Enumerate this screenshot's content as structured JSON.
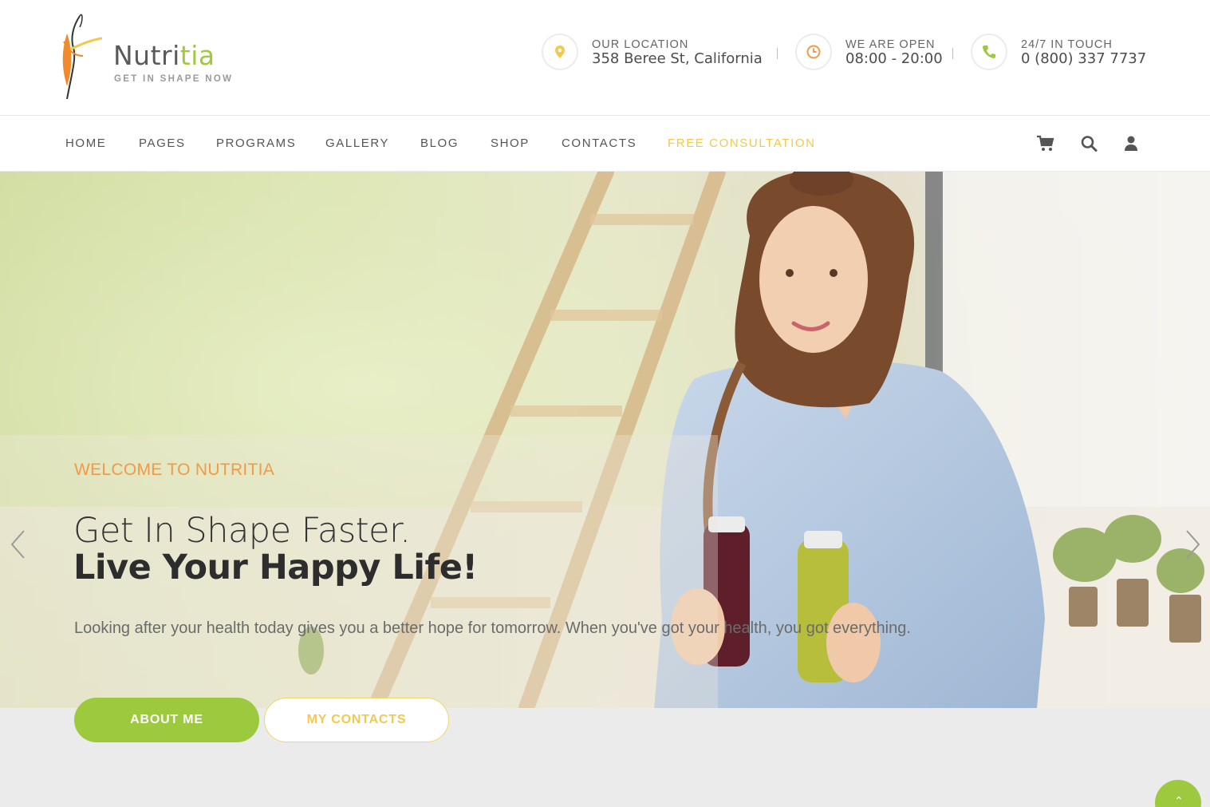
{
  "brand": {
    "name_start": "Nutri",
    "name_accent": "tia",
    "tagline": "GET IN SHAPE NOW"
  },
  "header_info": [
    {
      "icon": "location-pin-icon",
      "label": "OUR LOCATION",
      "value": "358 Beree St, California"
    },
    {
      "icon": "clock-icon",
      "label": "WE ARE OPEN",
      "value": "08:00 - 20:00"
    },
    {
      "icon": "phone-icon",
      "label": "24/7 IN TOUCH",
      "value": "0 (800) 337 7737"
    }
  ],
  "nav": {
    "items": [
      "HOME",
      "PAGES",
      "PROGRAMS",
      "GALLERY",
      "BLOG",
      "SHOP",
      "CONTACTS"
    ],
    "cta": "FREE CONSULTATION",
    "icons": [
      "cart-icon",
      "search-icon",
      "user-icon"
    ]
  },
  "hero": {
    "eyebrow": "WELCOME TO NUTRITIA",
    "headline_line1": "Get In Shape Faster.",
    "headline_line2": "Live Your Happy Life!",
    "description": "Looking after your health today gives you a better hope for tomorrow. When you've got your health, you got everything.",
    "primary_button": "ABOUT ME",
    "secondary_button": "MY CONTACTS"
  },
  "colors": {
    "brand_green": "#9cc93d",
    "accent_yellow": "#f2c94c",
    "accent_orange": "#f29a45",
    "text_dark": "#333333"
  }
}
